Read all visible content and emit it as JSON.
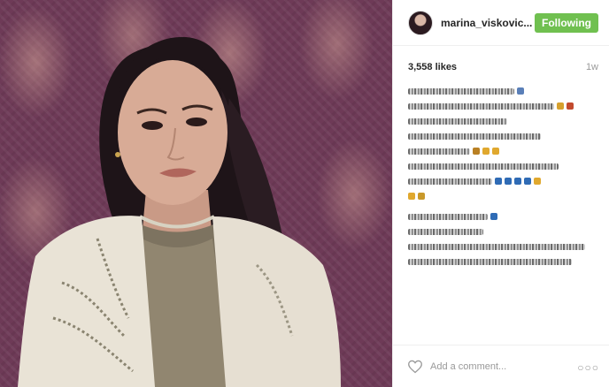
{
  "post": {
    "username": "marina_viskovic...",
    "follow_label": "Following",
    "likes": "3,558 likes",
    "time": "1w",
    "comment_placeholder": "Add a comment...",
    "more_label": "○○○"
  },
  "colors": {
    "follow_button": "#70c050",
    "wallpaper": "#6e3a57"
  },
  "icons": {
    "like": "heart-icon",
    "options": "more-options-icon"
  }
}
